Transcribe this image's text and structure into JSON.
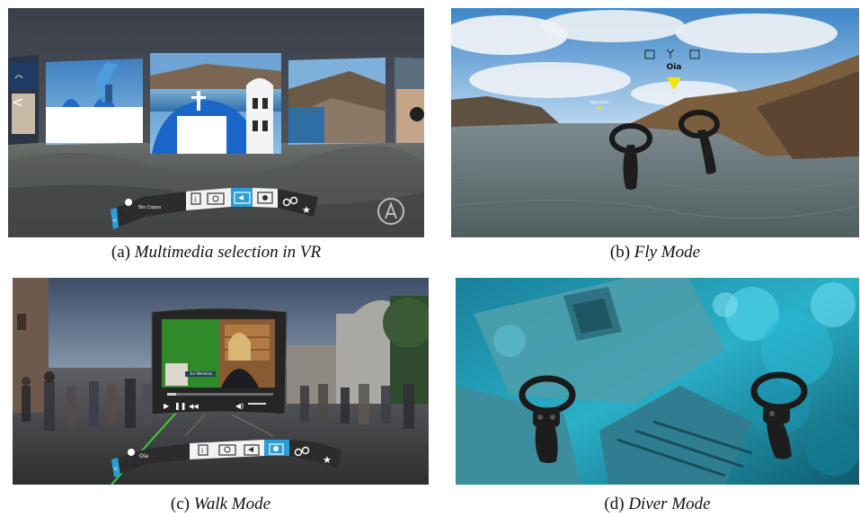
{
  "panels": {
    "a": {
      "caption_label": "(a)",
      "caption_text": "Multimedia selection in VR",
      "menu": {
        "location": "Sto Copos",
        "back_label": "<",
        "buttons": [
          "info-icon",
          "gallery-icon",
          "video-icon",
          "photo-icon",
          "location-pins-icon",
          "star-icon"
        ]
      }
    },
    "b": {
      "caption_label": "(b)",
      "caption_text": "Fly Mode",
      "poi_label": "Oia",
      "small_label": "Agia Eirini"
    },
    "c": {
      "caption_label": "(c)",
      "caption_text": "Walk Mode",
      "video_caption": "Evi Nomikou",
      "menu": {
        "location": "Oia",
        "back_label": "<"
      }
    },
    "d": {
      "caption_label": "(d)",
      "caption_text": "Diver Mode"
    }
  },
  "colors": {
    "accent": "#2a9fd6",
    "menu_bg": "#2c2c2c",
    "menu_light": "#f2f2f2",
    "marker": "#f5e400"
  }
}
